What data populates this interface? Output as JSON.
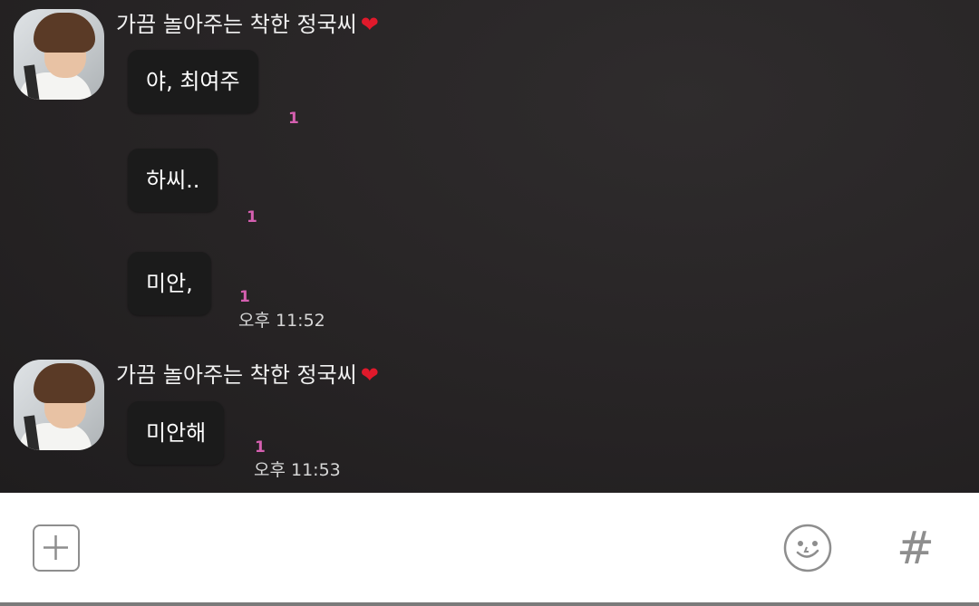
{
  "messages": [
    {
      "sender": "가끔 놀아주는 착한 정국씨",
      "sender_icon": "heart-icon",
      "bubbles": [
        {
          "text": "야, 최여주",
          "unread": "1"
        },
        {
          "text": "하씨..",
          "unread": "1"
        },
        {
          "text": "미안,",
          "unread": "1",
          "time": "오후 11:52"
        }
      ]
    },
    {
      "sender": "가끔 놀아주는 착한 정국씨",
      "sender_icon": "heart-icon",
      "bubbles": [
        {
          "text": "미안해",
          "unread": "1",
          "time": "오후 11:53"
        }
      ]
    }
  ],
  "input_bar": {
    "plus_icon": "plus-icon",
    "emoji_icon": "emoji-icon",
    "hash_label": "#"
  },
  "colors": {
    "chat_background": "#262324",
    "bubble_background": "#1b1b1b",
    "unread_color": "#d55fb0",
    "heart_color": "#e0192b"
  }
}
